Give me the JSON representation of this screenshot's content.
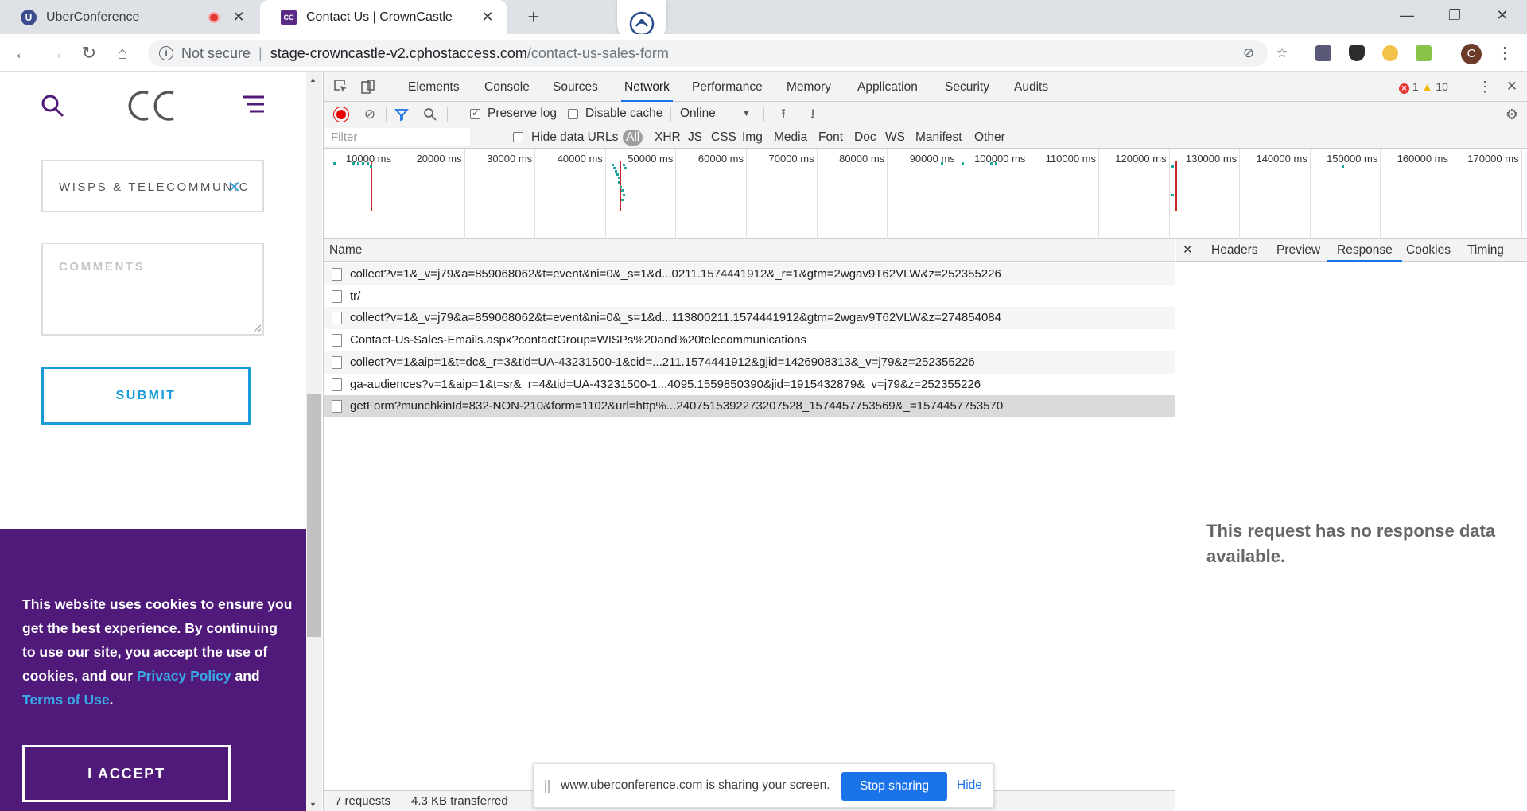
{
  "browser": {
    "tabs": [
      {
        "title": "UberConference",
        "favicon": "U"
      },
      {
        "title": "Contact Us | CrownCastle",
        "favicon": "CC"
      }
    ],
    "url_host": "stage-crowncastle-v2.cphostaccess.com",
    "url_path": "/contact-us-sales-form",
    "security_label": "Not secure",
    "avatar_letter": "C"
  },
  "page": {
    "select_value": "WISPS & TELECOMMUNIC",
    "comments_placeholder": "COMMENTS",
    "submit_label": "SUBMIT",
    "cookie": {
      "text_1": "This website uses cookies to ensure you get the best experience. By continuing to use our site, you accept the use of cookies, and our ",
      "privacy_link": "Privacy Policy",
      "and": " and ",
      "terms_link": "Terms of Use",
      "end": ".",
      "accept_label": "I ACCEPT"
    }
  },
  "devtools": {
    "tabs": [
      "Elements",
      "Console",
      "Sources",
      "Network",
      "Performance",
      "Memory",
      "Application",
      "Security",
      "Audits"
    ],
    "active_tab": "Network",
    "errors": "1",
    "warnings": "10",
    "toolbar": {
      "preserve_log": "Preserve log",
      "disable_cache": "Disable cache",
      "throttle": "Online"
    },
    "filter": {
      "placeholder": "Filter",
      "hide_data_urls": "Hide data URLs",
      "types": [
        "All",
        "XHR",
        "JS",
        "CSS",
        "Img",
        "Media",
        "Font",
        "Doc",
        "WS",
        "Manifest",
        "Other"
      ]
    },
    "timeline_labels": [
      "10000 ms",
      "20000 ms",
      "30000 ms",
      "40000 ms",
      "50000 ms",
      "60000 ms",
      "70000 ms",
      "80000 ms",
      "90000 ms",
      "100000 ms",
      "110000 ms",
      "120000 ms",
      "130000 ms",
      "140000 ms",
      "150000 ms",
      "160000 ms",
      "170000 ms"
    ],
    "name_header": "Name",
    "requests": [
      "collect?v=1&_v=j79&a=859068062&t=event&ni=0&_s=1&d...0211.1574441912&_r=1&gtm=2wgav9T62VLW&z=252355226",
      "tr/",
      "collect?v=1&_v=j79&a=859068062&t=event&ni=0&_s=1&d...113800211.1574441912&gtm=2wgav9T62VLW&z=274854084",
      "Contact-Us-Sales-Emails.aspx?contactGroup=WISPs%20and%20telecommunications",
      "collect?v=1&aip=1&t=dc&_r=3&tid=UA-43231500-1&cid=...211.1574441912&gjid=1426908313&_v=j79&z=252355226",
      "ga-audiences?v=1&aip=1&t=sr&_r=4&tid=UA-43231500-1...4095.1559850390&jid=1915432879&_v=j79&z=252355226",
      "getForm?munchkinId=832-NON-210&form=1102&url=http%...2407515392273207528_1574457753569&_=1574457753570"
    ],
    "detail_tabs": [
      "Headers",
      "Preview",
      "Response",
      "Cookies",
      "Timing"
    ],
    "active_detail_tab": "Response",
    "no_response": "This request has no response data available.",
    "status": {
      "requests": "7 requests",
      "transferred": "4.3 KB transferred"
    }
  },
  "share_bar": {
    "message": "www.uberconference.com is sharing your screen.",
    "stop_label": "Stop sharing",
    "hide_label": "Hide"
  },
  "colors": {
    "cookie_bg": "#4f1a79",
    "submit_accent": "#189cd8",
    "devtools_accent": "#1a73e8"
  }
}
